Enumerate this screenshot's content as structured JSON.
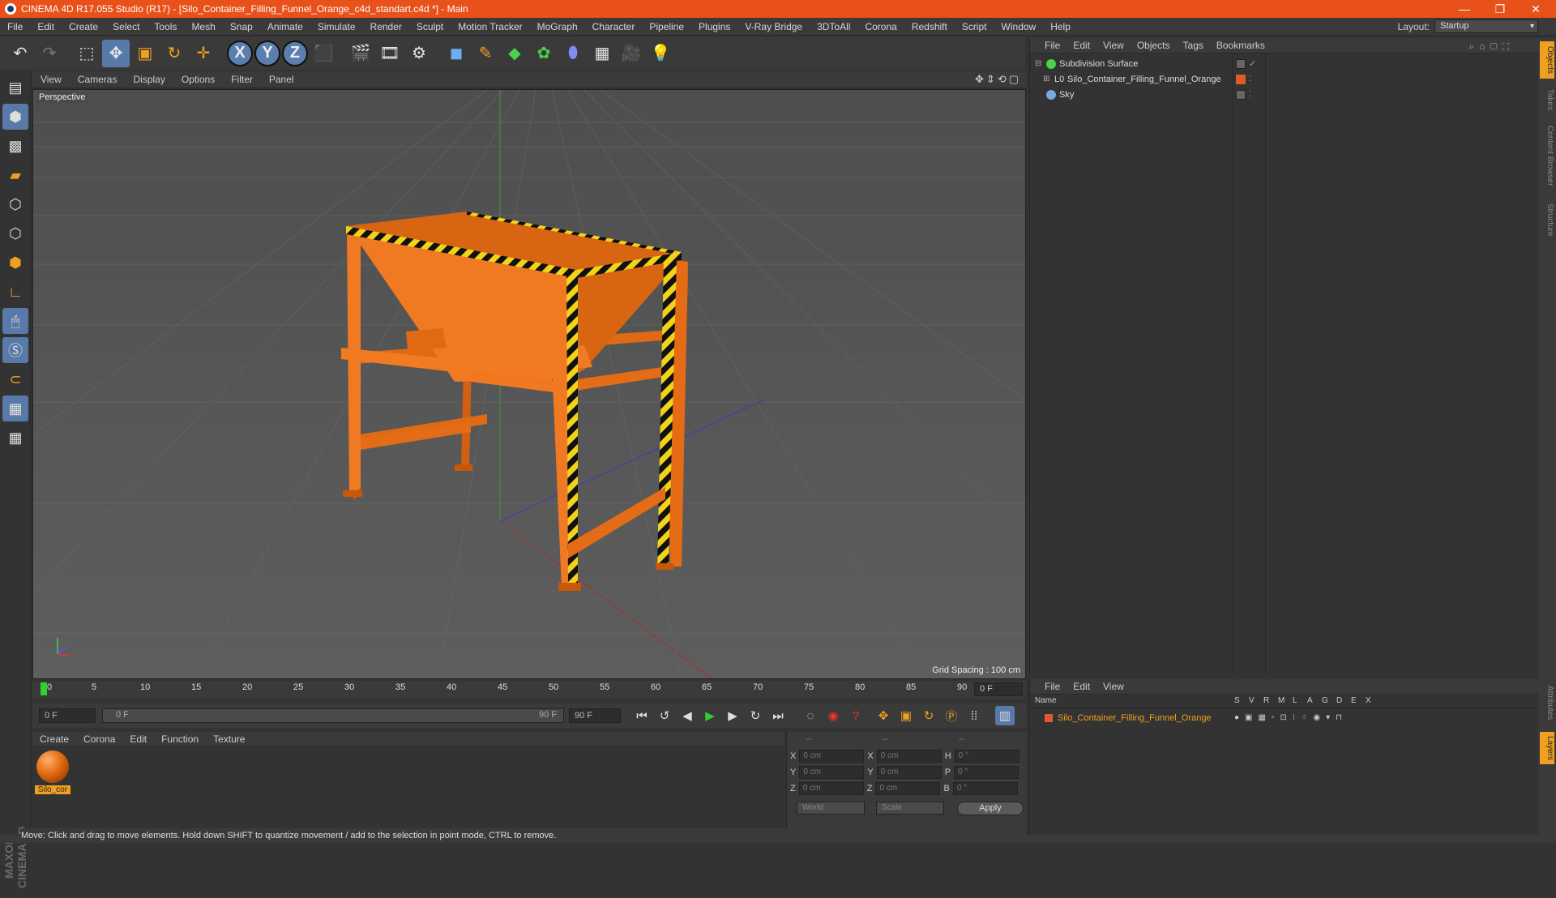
{
  "window": {
    "title": "CINEMA 4D R17.055 Studio (R17) - [Silo_Container_Filling_Funnel_Orange_c4d_standart.c4d *] - Main",
    "minimize": "—",
    "restore": "❐",
    "close": "✕"
  },
  "menu": [
    "File",
    "Edit",
    "Create",
    "Select",
    "Tools",
    "Mesh",
    "Snap",
    "Animate",
    "Simulate",
    "Render",
    "Sculpt",
    "Motion Tracker",
    "MoGraph",
    "Character",
    "Pipeline",
    "Plugins",
    "V-Ray Bridge",
    "3DToAll",
    "Corona",
    "Redshift",
    "Script",
    "Window",
    "Help"
  ],
  "layout": {
    "label": "Layout:",
    "value": "Startup"
  },
  "viewport": {
    "menu": [
      "View",
      "Cameras",
      "Display",
      "Options",
      "Filter",
      "Panel"
    ],
    "camera_label": "Perspective",
    "grid_spacing": "Grid Spacing : 100 cm"
  },
  "timeline": {
    "ticks": [
      "0",
      "5",
      "10",
      "15",
      "20",
      "25",
      "30",
      "35",
      "40",
      "45",
      "50",
      "55",
      "60",
      "65",
      "70",
      "75",
      "80",
      "85",
      "90"
    ],
    "current_frame": "0 F",
    "start_field": "0 F",
    "range_start": "0 F",
    "range_end": "90 F",
    "end_field": "90 F"
  },
  "material_manager": {
    "menu": [
      "Create",
      "Corona",
      "Edit",
      "Function",
      "Texture"
    ],
    "materials": [
      {
        "name": "Silo_cor",
        "color": "#e36a10"
      }
    ]
  },
  "coordinates": {
    "headers": [
      "--",
      "--",
      "--"
    ],
    "rows": [
      {
        "a": "X",
        "av": "0 cm",
        "b": "X",
        "bv": "0 cm",
        "c": "H",
        "cv": "0 °"
      },
      {
        "a": "Y",
        "av": "0 cm",
        "b": "Y",
        "bv": "0 cm",
        "c": "P",
        "cv": "0 °"
      },
      {
        "a": "Z",
        "av": "0 cm",
        "b": "Z",
        "bv": "0 cm",
        "c": "B",
        "cv": "0 °"
      }
    ],
    "mode1": "World",
    "mode2": "Scale",
    "apply": "Apply"
  },
  "object_manager": {
    "menu": [
      "File",
      "Edit",
      "View",
      "Objects",
      "Tags",
      "Bookmarks"
    ],
    "objects": [
      {
        "name": "Subdivision Surface",
        "icon_color": "#4bd14b"
      },
      {
        "name": "Silo_Container_Filling_Funnel_Orange",
        "icon_color": "#8aa0c0"
      },
      {
        "name": "Sky",
        "icon_color": "#7aa7e0"
      }
    ]
  },
  "layer_manager": {
    "menu": [
      "File",
      "Edit",
      "View"
    ],
    "columns": [
      "Name",
      "S",
      "V",
      "R",
      "M",
      "L",
      "A",
      "G",
      "D",
      "E",
      "X"
    ],
    "layers": [
      {
        "name": "Silo_Container_Filling_Funnel_Orange",
        "color": "#e05a2a"
      }
    ]
  },
  "right_tabs": [
    "Objects",
    "Takes",
    "Content Browser",
    "Structure",
    "Attributes",
    "Layers"
  ],
  "status": "Move: Click and drag to move elements. Hold down SHIFT to quantize movement / add to the selection in point mode, CTRL to remove.",
  "branding": "MAXON CINEMA 4D",
  "colors": {
    "accent": "#e8511a",
    "selection_blue": "#587aa8",
    "model_orange": "#e86a12"
  }
}
